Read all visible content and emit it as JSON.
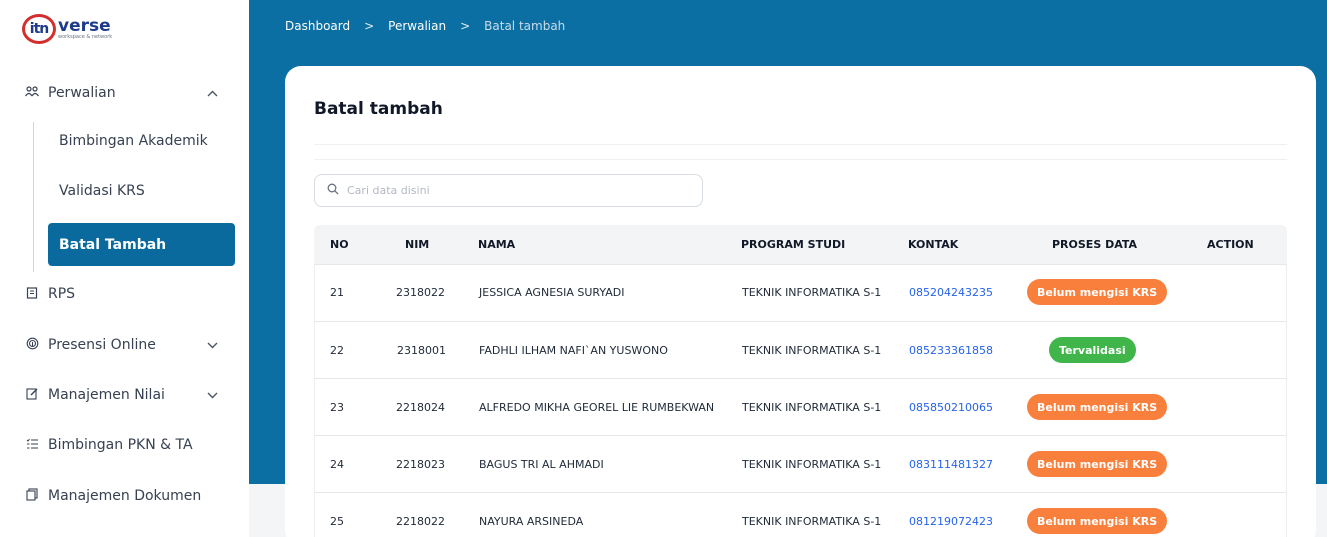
{
  "logo": {
    "mark": "itn",
    "word": "verse",
    "tagline": "workspace & network"
  },
  "sidebar": {
    "perwalian": {
      "icon": "users-icon",
      "label": "Perwalian",
      "chevron": "^"
    },
    "sub_items": [
      "Bimbingan Akademik",
      "Validasi KRS",
      "Batal Tambah"
    ],
    "items": [
      {
        "icon": "book-icon",
        "label": "RPS",
        "chevron": ""
      },
      {
        "icon": "fingerprint-icon",
        "label": "Presensi Online",
        "chevron": "⌄"
      },
      {
        "icon": "edit-icon",
        "label": "Manajemen Nilai",
        "chevron": "⌄"
      },
      {
        "icon": "list-icon",
        "label": "Bimbingan PKN & TA",
        "chevron": ""
      },
      {
        "icon": "document-icon",
        "label": "Manajemen Dokumen",
        "chevron": ""
      }
    ],
    "active_color": "#0a6a9e"
  },
  "breadcrumb": {
    "items": [
      "Dashboard",
      "Perwalian",
      "Batal tambah"
    ],
    "separator": ">"
  },
  "card": {
    "title": "Batal tambah",
    "search_placeholder": "Cari data disini"
  },
  "table": {
    "headers": [
      "NO",
      "NIM",
      "NAMA",
      "PROGRAM STUDI",
      "KONTAK",
      "PROSES DATA",
      "ACTION"
    ],
    "rows": [
      {
        "no": "21",
        "nim": "2318022",
        "nama": "JESSICA AGNESIA SURYADI",
        "prodi": "TEKNIK INFORMATIKA S-1",
        "kontak": "085204243235",
        "status": "Belum mengisi KRS",
        "status_type": "orange"
      },
      {
        "no": "22",
        "nim": "2318001",
        "nama": "FADHLI ILHAM NAFI`AN YUSWONO",
        "prodi": "TEKNIK INFORMATIKA S-1",
        "kontak": "085233361858",
        "status": "Tervalidasi",
        "status_type": "green"
      },
      {
        "no": "23",
        "nim": "2218024",
        "nama": "ALFREDO MIKHA GEOREL LIE RUMBEKWAN",
        "prodi": "TEKNIK INFORMATIKA S-1",
        "kontak": "085850210065",
        "status": "Belum mengisi KRS",
        "status_type": "orange"
      },
      {
        "no": "24",
        "nim": "2218023",
        "nama": "BAGUS TRI AL AHMADI",
        "prodi": "TEKNIK INFORMATIKA S-1",
        "kontak": "083111481327",
        "status": "Belum mengisi KRS",
        "status_type": "orange"
      },
      {
        "no": "25",
        "nim": "2218022",
        "nama": "NAYURA ARSINEDA",
        "prodi": "TEKNIK INFORMATIKA S-1",
        "kontak": "081219072423",
        "status": "Belum mengisi KRS",
        "status_type": "orange"
      }
    ]
  },
  "colors": {
    "header_bg": "#0b6fa4",
    "badge_orange": "#f97f3c",
    "badge_green": "#3fb54a",
    "link": "#2563eb"
  }
}
